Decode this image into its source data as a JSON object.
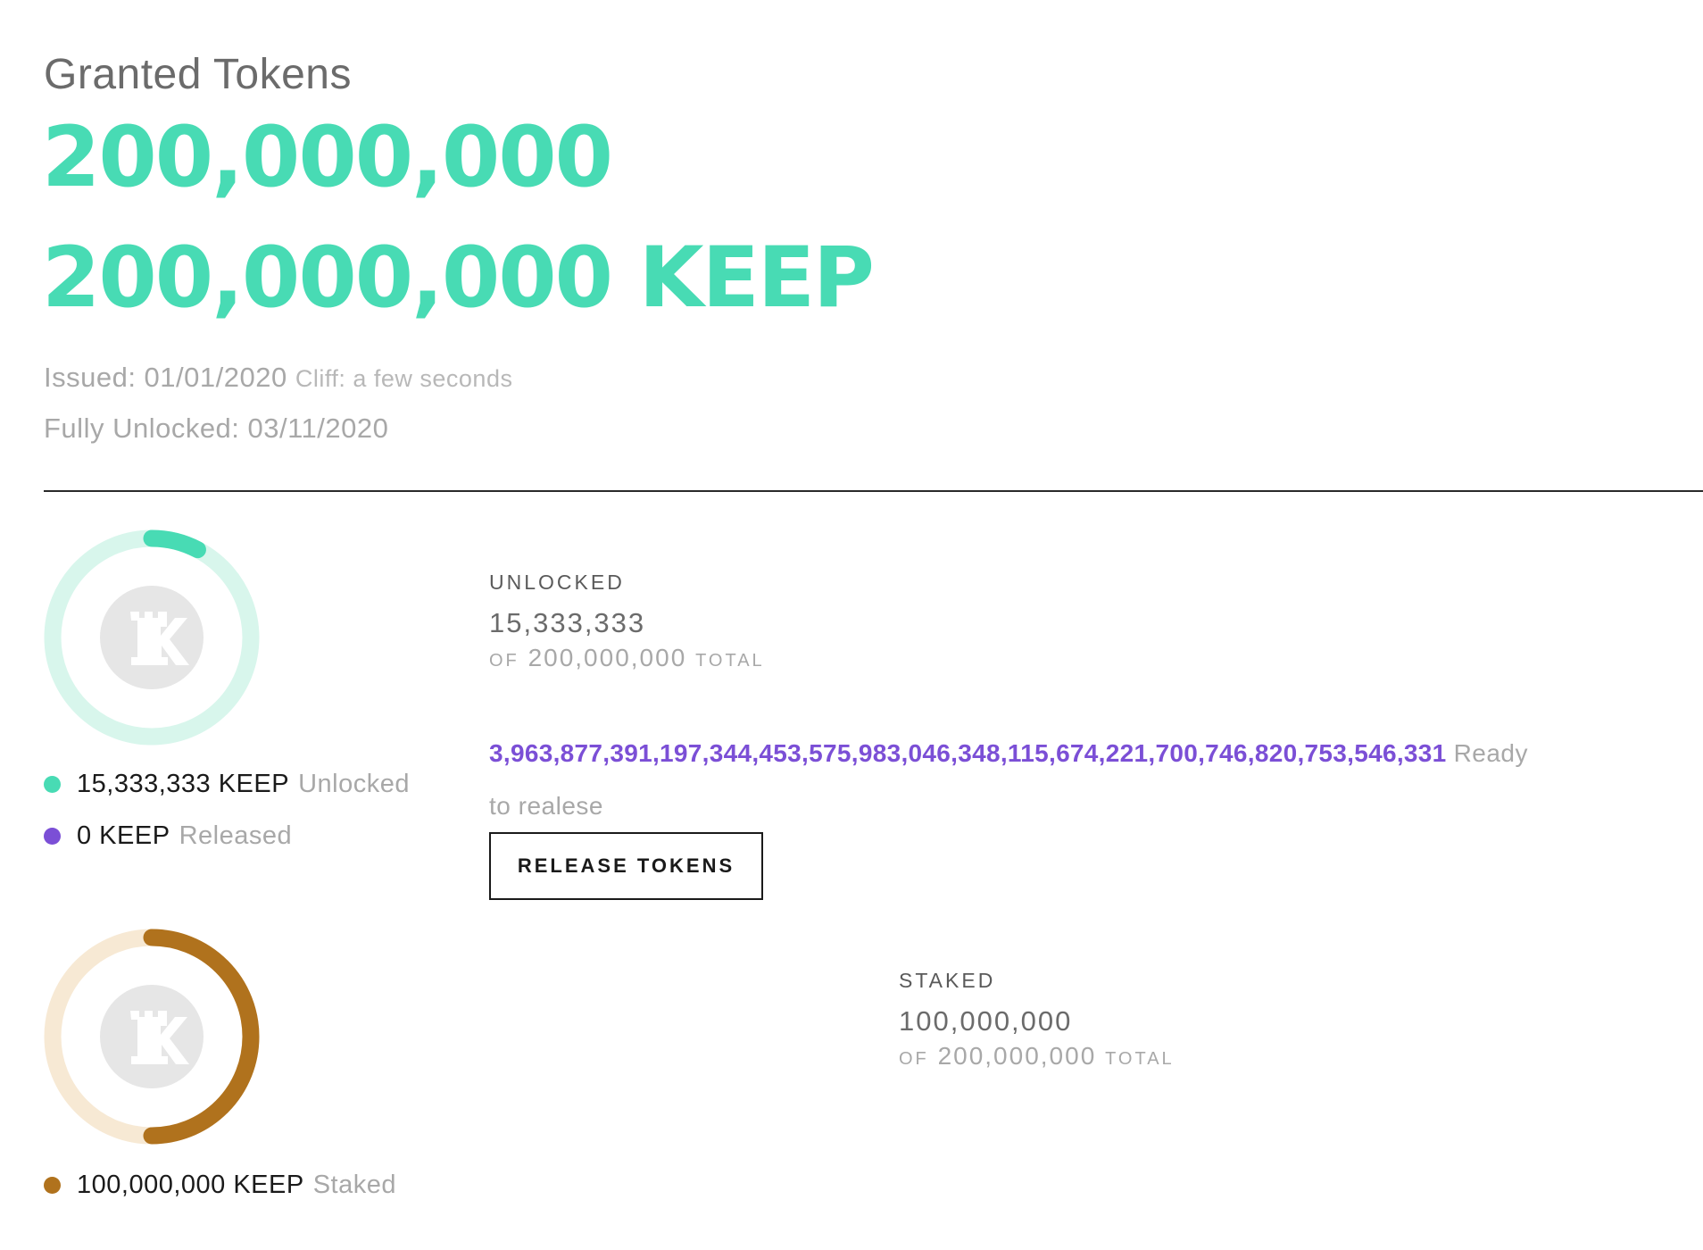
{
  "header": {
    "title": "Granted Tokens",
    "amount": "200,000,000",
    "amount_keep": "200,000,000 KEEP"
  },
  "meta": {
    "issued_label": "Issued: 01/01/2020",
    "cliff_label": "Cliff: a few seconds",
    "fully_unlocked_label": "Fully Unlocked: 03/11/2020"
  },
  "unlocked_ring": {
    "fraction": 0.0767,
    "track_color": "#d8f6ec",
    "fill_color": "#48dbb4",
    "icon": "keep-logo-icon",
    "legend": [
      {
        "value": "15,333,333 KEEP",
        "label": "Unlocked",
        "color": "#48dbb4"
      },
      {
        "value": "0 KEEP",
        "label": "Released",
        "color": "#7b4fd6"
      }
    ]
  },
  "unlocked_stats": {
    "label": "UNLOCKED",
    "value": "15,333,333",
    "of_prefix": "OF",
    "of_total": "200,000,000",
    "of_suffix": "TOTAL"
  },
  "release": {
    "amount": "3,963,877,391,197,344,453,575,983,046,348,115,674,221,700,746,820,753,546,331",
    "ready_word": "Ready",
    "ready_rest": "to realese",
    "button_label": "RELEASE TOKENS"
  },
  "staked_ring": {
    "fraction": 0.5,
    "track_color": "#f7e9d4",
    "fill_color": "#b0721d",
    "icon": "keep-logo-icon",
    "legend": [
      {
        "value": "100,000,000 KEEP",
        "label": "Staked",
        "color": "#b0721d"
      }
    ]
  },
  "staked_stats": {
    "label": "STAKED",
    "value": "100,000,000",
    "of_prefix": "OF",
    "of_total": "200,000,000",
    "of_suffix": "TOTAL"
  },
  "colors": {
    "accent_green": "#48dbb4",
    "accent_purple": "#7b4fd6",
    "accent_brown": "#b0721d"
  }
}
